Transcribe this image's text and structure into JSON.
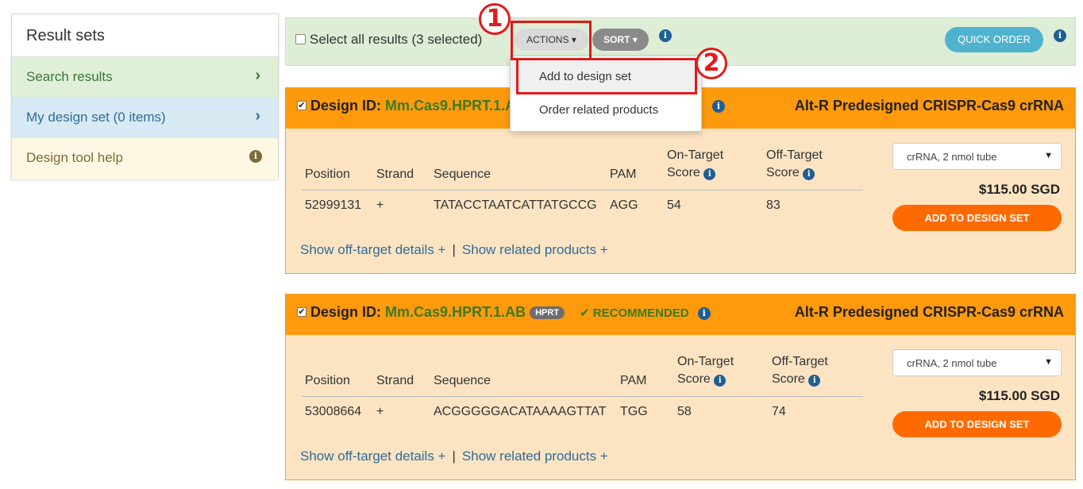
{
  "sidebar": {
    "title": "Result sets",
    "items": [
      {
        "label": "Search results",
        "icon": "chevron-right-icon"
      },
      {
        "label": "My design set (0 items)",
        "icon": "chevron-right-icon"
      },
      {
        "label": "Design tool help",
        "icon": "info-icon"
      }
    ]
  },
  "toolbar": {
    "select_all_label": "Select all results (3 selected)",
    "actions_label": "ACTIONS ▾",
    "sort_label": "SORT ▾",
    "quick_order_label": "QUICK ORDER"
  },
  "dropdown": {
    "items": [
      "Add to design set",
      "Order related products"
    ]
  },
  "annotations": {
    "step1": "1",
    "step2": "2"
  },
  "columns": {
    "position": "Position",
    "strand": "Strand",
    "sequence": "Sequence",
    "pam": "PAM",
    "on_target_1": "On-Target",
    "on_target_2": "Score",
    "off_target_1": "Off-Target",
    "off_target_2": "Score"
  },
  "links": {
    "off_target": "Show off-target details +",
    "separator": "|",
    "related": "Show related products +"
  },
  "results": [
    {
      "design_id_label": "Design ID:",
      "design_id": "Mm.Cas9.HPRT.1.A",
      "title": "Alt-R Predesigned CRISPR-Cas9 crRNA",
      "position": "52999131",
      "strand": "+",
      "sequence": "TATACCTAATCATTATGCCG",
      "pam": "AGG",
      "on_target": "54",
      "off_target": "83",
      "product": "crRNA, 2 nmol tube",
      "price": "$115.00 SGD",
      "add_label": "ADD TO DESIGN SET"
    },
    {
      "design_id_label": "Design ID:",
      "design_id": "Mm.Cas9.HPRT.1.AB",
      "badge": "HPRT",
      "recommended": "✔ RECOMMENDED",
      "title": "Alt-R Predesigned CRISPR-Cas9 crRNA",
      "position": "53008664",
      "strand": "+",
      "sequence": "ACGGGGGACATAAAAGTTAT",
      "pam": "TGG",
      "on_target": "58",
      "off_target": "74",
      "product": "crRNA, 2 nmol tube",
      "price": "$115.00 SGD",
      "add_label": "ADD TO DESIGN SET"
    }
  ],
  "colors": {
    "accent_orange": "#ff9a0d",
    "add_button": "#ff6a00",
    "quick_order": "#4fb3cf",
    "annotation_red": "#e01b1b"
  }
}
